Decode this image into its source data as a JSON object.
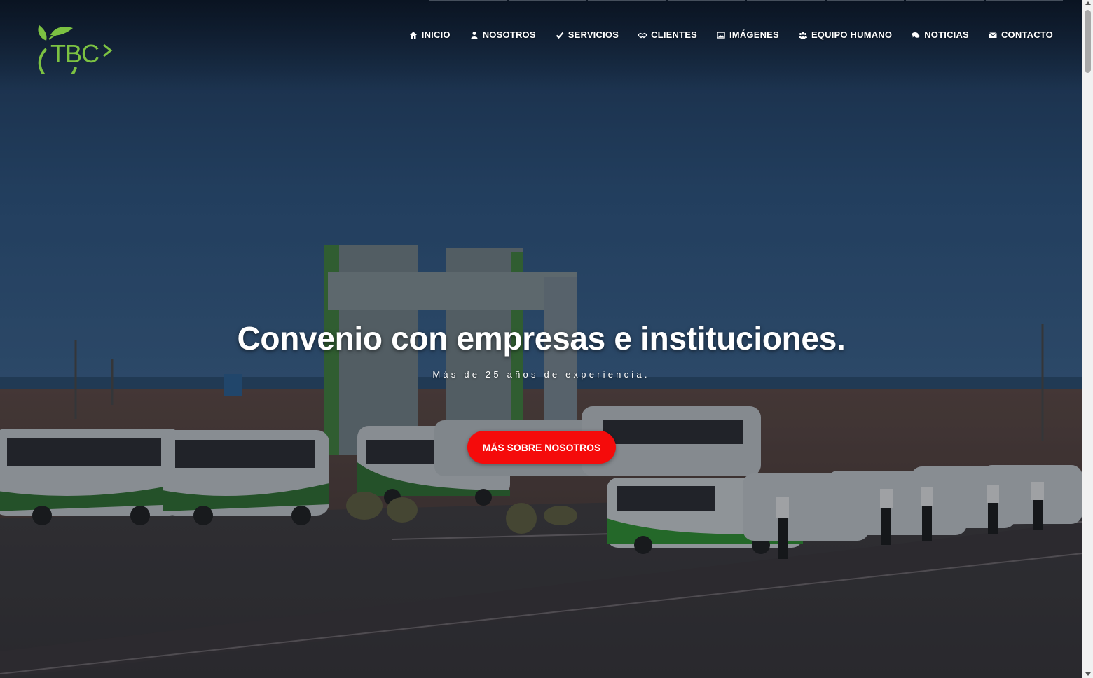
{
  "brand": {
    "logo_text": "TBC",
    "accent": "#7cc242"
  },
  "nav": [
    {
      "label": "INICIO",
      "icon": "home-icon"
    },
    {
      "label": "NOSOTROS",
      "icon": "user-icon"
    },
    {
      "label": "SERVICIOS",
      "icon": "check-icon"
    },
    {
      "label": "CLIENTES",
      "icon": "handshake-icon"
    },
    {
      "label": "IMÁGENES",
      "icon": "image-icon"
    },
    {
      "label": "EQUIPO HUMANO",
      "icon": "users-icon"
    },
    {
      "label": "NOTICIAS",
      "icon": "comments-icon"
    },
    {
      "label": "CONTACTO",
      "icon": "envelope-icon"
    }
  ],
  "hero": {
    "headline": "Convenio con empresas e instituciones.",
    "subline": "Más de 25 años de experiencia.",
    "cta_label": "MÁS SOBRE NOSOTROS",
    "cta_color": "#f50b0b"
  }
}
